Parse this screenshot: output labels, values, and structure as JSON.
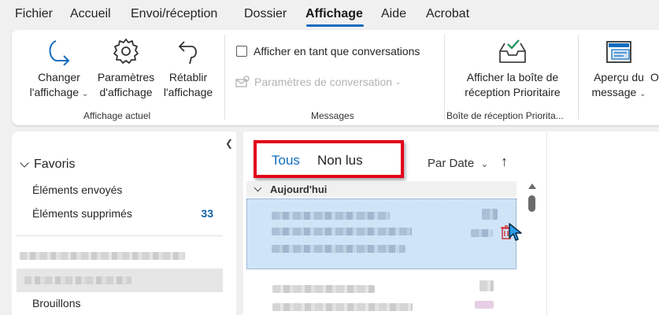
{
  "menu": {
    "tabs": [
      "Fichier",
      "Accueil",
      "Envoi/réception",
      "Dossier",
      "Affichage",
      "Aide",
      "Acrobat"
    ],
    "active": "Affichage"
  },
  "ribbon": {
    "change_view": {
      "line1": "Changer",
      "line2": "l'affichage",
      "icon": "change-view-arrow-icon"
    },
    "view_settings": {
      "line1": "Paramètres",
      "line2": "d'affichage",
      "icon": "gear-icon"
    },
    "reset_view": {
      "line1": "Rétablir",
      "line2": "l'affichage",
      "icon": "undo-arrow-icon"
    },
    "current_view_label": "Affichage actuel",
    "show_as_conversations": "Afficher en tant que conversations",
    "conversation_settings": "Paramètres de conversation",
    "messages_label": "Messages",
    "focused_inbox": {
      "line1": "Afficher la boîte de",
      "line2": "réception Prioritaire",
      "icon": "inbox-check-icon"
    },
    "focused_inbox_group_label": "Boîte de réception Priorita...",
    "reading_pane": {
      "line1": "Aperçu du",
      "line2": "message",
      "icon": "reading-pane-icon"
    },
    "cut_letter": "O"
  },
  "nav": {
    "favorites": "Favoris",
    "items": [
      {
        "label": "Éléments envoyés"
      },
      {
        "label": "Éléments supprimés",
        "count": "33"
      }
    ],
    "drafts": "Brouillons"
  },
  "list": {
    "filter_all": "Tous",
    "filter_unread": "Non lus",
    "sort_label": "Par Date",
    "sort_direction_icon": "arrow-up-icon",
    "section_today": "Aujourd'hui"
  },
  "colors": {
    "accent": "#0f6cbd",
    "highlight_box": "#e3001b",
    "selected_mail": "#cfe4f7"
  }
}
